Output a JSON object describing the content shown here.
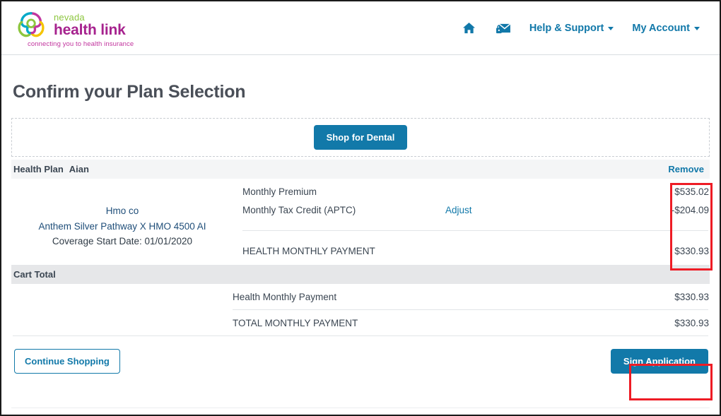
{
  "header": {
    "brand": {
      "line1": "nevada",
      "line2": "health link",
      "tagline": "connecting you to health insurance"
    },
    "nav": {
      "home_icon": "home-icon",
      "message_icon": "secure-message-icon",
      "help_label": "Help & Support",
      "account_label": "My Account"
    }
  },
  "page": {
    "title": "Confirm your Plan Selection"
  },
  "dental": {
    "shop_button": "Shop for Dental"
  },
  "cart": {
    "header": {
      "title": "Health Plan",
      "plan_kind": "Aian",
      "remove_label": "Remove"
    },
    "plan": {
      "issuer": "Hmo co",
      "name": "Anthem Silver Pathway X HMO 4500 AI",
      "coverage_start": "Coverage Start Date: 01/01/2020"
    },
    "charges": [
      {
        "label": "Monthly Premium",
        "action": "",
        "amount": "$535.02"
      },
      {
        "label": "Monthly Tax Credit (APTC)",
        "action": "Adjust",
        "amount": "-$204.09"
      }
    ],
    "health_total": {
      "label": "HEALTH MONTHLY PAYMENT",
      "amount": "$330.93"
    }
  },
  "cart_total": {
    "band_label": "Cart Total",
    "lines": [
      {
        "label": "Health Monthly Payment",
        "amount": "$330.93"
      },
      {
        "label": "TOTAL MONTHLY PAYMENT",
        "amount": "$330.93"
      }
    ]
  },
  "actions": {
    "continue_shopping": "Continue Shopping",
    "sign_application": "Sign Application"
  },
  "colors": {
    "brand_green": "#8dc63f",
    "brand_magenta": "#a6228e",
    "link_blue": "#1178a9",
    "button_blue": "#1279a9",
    "highlight_red": "#ee1c25",
    "band_grey": "#e6e7e9",
    "header_grey": "#f4f5f6"
  }
}
